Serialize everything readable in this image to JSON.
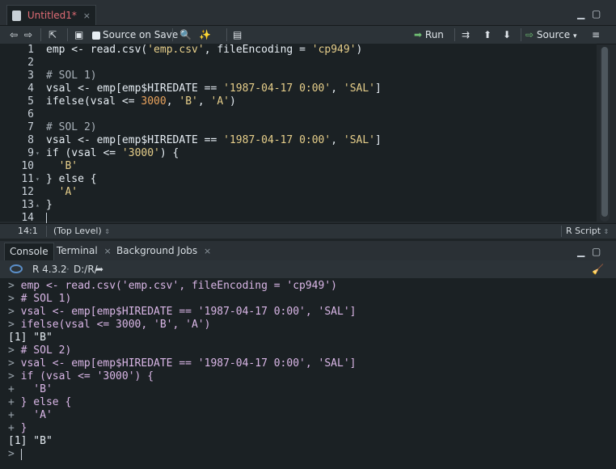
{
  "editor": {
    "tab_label": "Untitled1*",
    "tab_close": "×",
    "toolbar": {
      "source_on_save": "Source on Save",
      "run": "Run",
      "source": "Source"
    },
    "lines": [
      {
        "n": "1",
        "parts": [
          [
            "t",
            "emp <- read.csv("
          ],
          [
            "s",
            "'emp.csv'"
          ],
          [
            "t",
            ", fileEncoding = "
          ],
          [
            "s",
            "'cp949'"
          ],
          [
            "t",
            ")"
          ]
        ]
      },
      {
        "n": "2",
        "parts": []
      },
      {
        "n": "3",
        "parts": [
          [
            "c",
            "# SOL 1)"
          ]
        ]
      },
      {
        "n": "4",
        "parts": [
          [
            "t",
            "vsal <- emp[emp$HIREDATE == "
          ],
          [
            "s",
            "'1987-04-17 0:00'"
          ],
          [
            "t",
            ", "
          ],
          [
            "s",
            "'SAL'"
          ],
          [
            "t",
            "]"
          ]
        ]
      },
      {
        "n": "5",
        "parts": [
          [
            "t",
            "ifelse(vsal <= "
          ],
          [
            "n",
            "3000"
          ],
          [
            "t",
            ", "
          ],
          [
            "s",
            "'B'"
          ],
          [
            "t",
            ", "
          ],
          [
            "s",
            "'A'"
          ],
          [
            "t",
            ")"
          ]
        ]
      },
      {
        "n": "6",
        "parts": []
      },
      {
        "n": "7",
        "parts": [
          [
            "c",
            "# SOL 2)"
          ]
        ]
      },
      {
        "n": "8",
        "parts": [
          [
            "t",
            "vsal <- emp[emp$HIREDATE == "
          ],
          [
            "s",
            "'1987-04-17 0:00'"
          ],
          [
            "t",
            ", "
          ],
          [
            "s",
            "'SAL'"
          ],
          [
            "t",
            "]"
          ]
        ]
      },
      {
        "n": "9",
        "parts": [
          [
            "t",
            "if (vsal <= "
          ],
          [
            "s",
            "'3000'"
          ],
          [
            "t",
            ") {"
          ]
        ]
      },
      {
        "n": "10",
        "parts": [
          [
            "t",
            "  "
          ],
          [
            "s",
            "'B'"
          ]
        ]
      },
      {
        "n": "11",
        "parts": [
          [
            "t",
            "} else {"
          ]
        ]
      },
      {
        "n": "12",
        "parts": [
          [
            "t",
            "  "
          ],
          [
            "s",
            "'A'"
          ]
        ]
      },
      {
        "n": "13",
        "parts": [
          [
            "t",
            "}"
          ]
        ]
      },
      {
        "n": "14",
        "parts": []
      }
    ],
    "status": {
      "position": "14:1",
      "scope": "(Top Level)",
      "filetype": "R Script"
    }
  },
  "console": {
    "tabs": [
      "Console",
      "Terminal",
      "Background Jobs"
    ],
    "r_version": "R 4.3.2",
    "path": "D:/R/",
    "lines": [
      {
        "p": "> ",
        "k": "inp",
        "t": "emp <- read.csv('emp.csv', fileEncoding = 'cp949')"
      },
      {
        "p": "> ",
        "k": "inp",
        "t": "# SOL 1)"
      },
      {
        "p": "> ",
        "k": "inp",
        "t": "vsal <- emp[emp$HIREDATE == '1987-04-17 0:00', 'SAL']"
      },
      {
        "p": "> ",
        "k": "inp",
        "t": "ifelse(vsal <= 3000, 'B', 'A')"
      },
      {
        "p": "",
        "k": "out",
        "t": "[1] \"B\""
      },
      {
        "p": "> ",
        "k": "inp",
        "t": "# SOL 2)"
      },
      {
        "p": "> ",
        "k": "inp",
        "t": "vsal <- emp[emp$HIREDATE == '1987-04-17 0:00', 'SAL']"
      },
      {
        "p": "> ",
        "k": "inp",
        "t": "if (vsal <= '3000') {"
      },
      {
        "p": "+ ",
        "k": "inp",
        "t": "  'B'"
      },
      {
        "p": "+ ",
        "k": "inp",
        "t": "} else {"
      },
      {
        "p": "+ ",
        "k": "inp",
        "t": "  'A'"
      },
      {
        "p": "+ ",
        "k": "inp",
        "t": "}"
      },
      {
        "p": "",
        "k": "out",
        "t": "[1] \"B\""
      },
      {
        "p": "> ",
        "k": "inp",
        "t": ""
      }
    ]
  }
}
